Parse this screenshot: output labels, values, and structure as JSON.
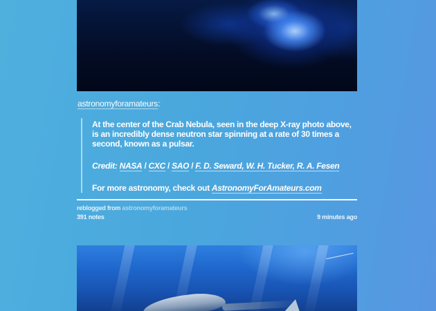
{
  "post1": {
    "source": {
      "username": "astronomyforamateurs",
      "suffix": ":"
    },
    "quote": {
      "paragraph1": "At the center of the Crab Nebula, seen in the deep X-ray photo above, is an incredibly dense neutron star spinning at a rate of 30 times a second, known as a pulsar.",
      "credit_label": "Credit:",
      "credit_links": [
        "NASA",
        "CXC",
        "SAO",
        "F. D. Seward, W. H. Tucker, R. A. Fesen"
      ],
      "separator": " / ",
      "more_prefix": "For more astronomy, check out ",
      "more_link": "AstronomyForAmateurs.com"
    },
    "meta": {
      "reblogged_from_label": "reblogged from",
      "reblogged_from_name": "astronomyforamateurs",
      "notes": "391 notes",
      "time": "9 minutes ago"
    }
  },
  "colors": {
    "background": "#4aa7dd",
    "text": "#ffffff"
  }
}
